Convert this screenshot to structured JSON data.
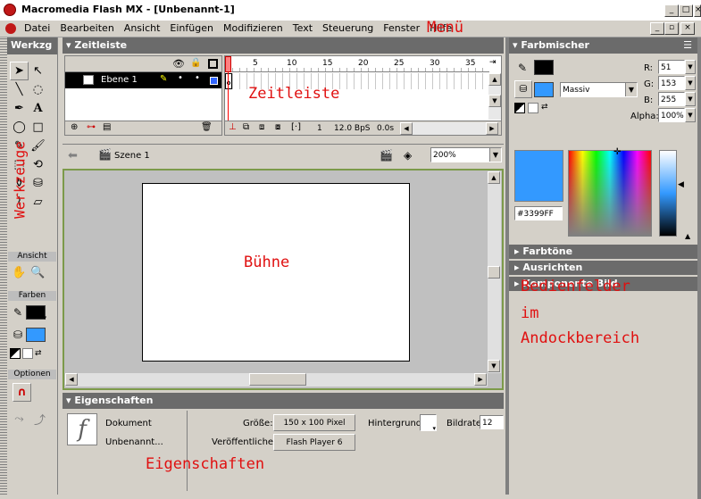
{
  "window": {
    "title": "Macromedia Flash MX - [Unbenannt-1]",
    "min": "_",
    "max": "□",
    "close": "×"
  },
  "menu": [
    "Datei",
    "Bearbeiten",
    "Ansicht",
    "Einfügen",
    "Modifizieren",
    "Text",
    "Steuerung",
    "Fenster",
    "Hilfe"
  ],
  "annotations": {
    "menu": "Menü",
    "timeline": "Zeitleiste",
    "tools": "Werkzeuge",
    "stage": "Bühne",
    "panels_line1": "Bedienfelder",
    "panels_line2": "im",
    "panels_line3": "Andockbereich",
    "properties": "Eigenschaften"
  },
  "tools_panel": {
    "title": "Werkzg",
    "ansicht": "Ansicht",
    "farben": "Farben",
    "optionen": "Optionen"
  },
  "timeline": {
    "title": "Zeitleiste",
    "layer_name": "Ebene 1",
    "frame_ticks": [
      "1",
      "5",
      "10",
      "15",
      "20",
      "25",
      "30",
      "35"
    ],
    "current_frame": "1",
    "fps": "12.0 BpS",
    "time": "0.0s"
  },
  "scene_bar": {
    "scene": "Szene 1",
    "zoom": "200%"
  },
  "properties": {
    "title": "Eigenschaften",
    "doc_label": "Dokument",
    "doc_name": "Unbenannt...",
    "size_label": "Größe:",
    "size_value": "150 x 100 Pixel",
    "publish_label": "Veröffentlichen:",
    "publish_value": "Flash Player 6",
    "bg_label": "Hintergrund:",
    "fps_label": "Bildrate:",
    "fps_value": "12"
  },
  "color_mixer": {
    "title": "Farbmischer",
    "fill_type": "Massiv",
    "r_label": "R:",
    "r": "51",
    "g_label": "G:",
    "g": "153",
    "b_label": "B:",
    "b": "255",
    "alpha_label": "Alpha:",
    "alpha": "100%",
    "hex": "#3399FF"
  },
  "collapsed_panels": [
    "Farbtöne",
    "Ausrichten",
    "Komponente Bild"
  ],
  "colors": {
    "fill": "#3399FF",
    "stroke": "#000000",
    "accent_red": "#e01010",
    "panel_head": "#6b6b6b"
  }
}
